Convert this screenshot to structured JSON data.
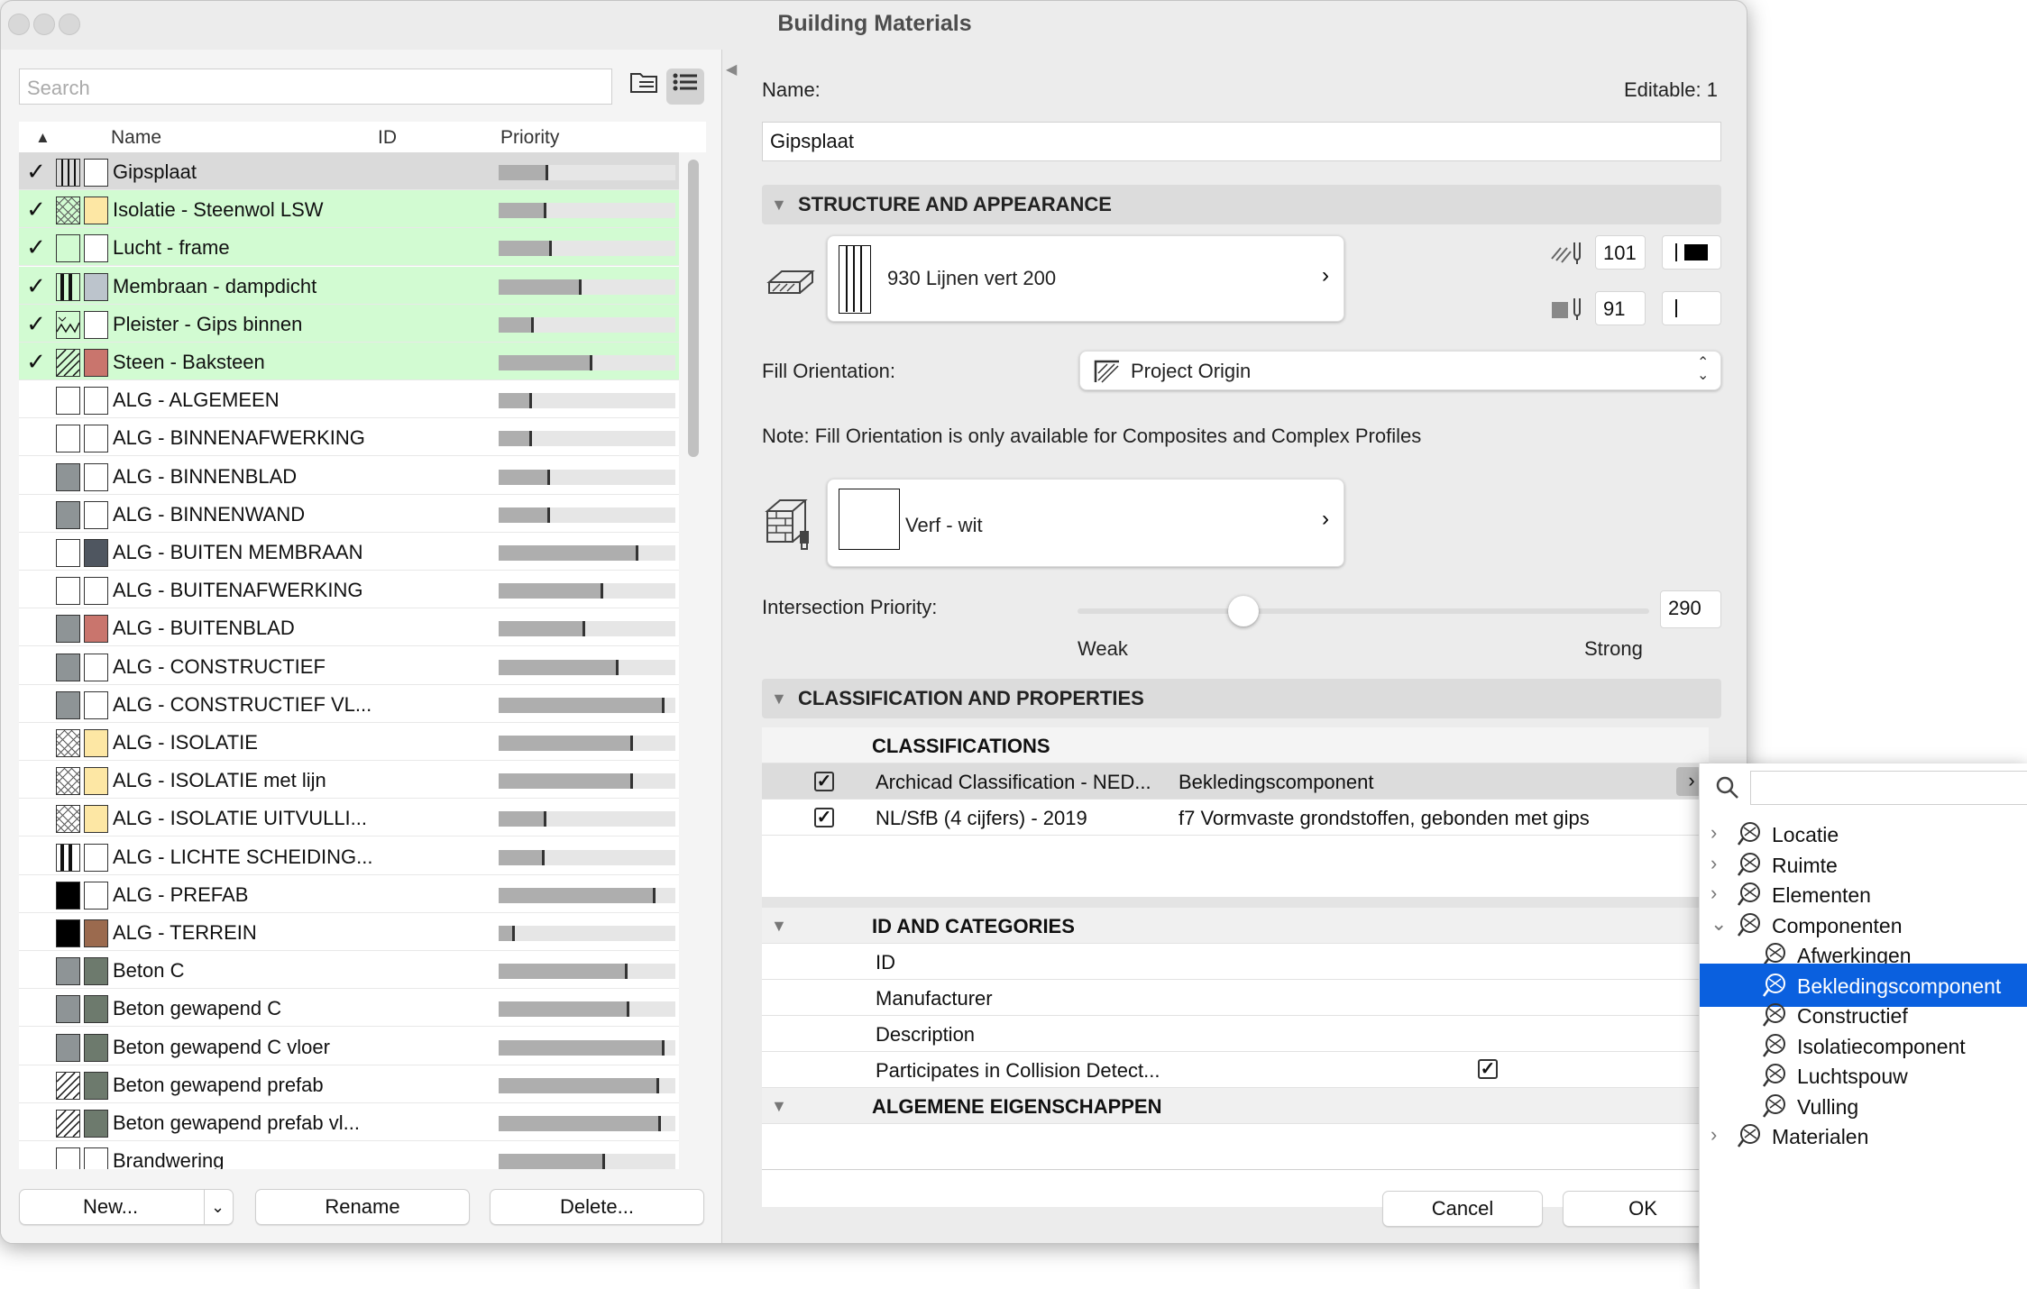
{
  "window": {
    "title": "Building Materials"
  },
  "left": {
    "search_placeholder": "Search",
    "columns": {
      "name": "Name",
      "id": "ID",
      "priority": "Priority"
    },
    "rows": [
      {
        "name": "Gipsplaat",
        "checked": true,
        "state": "selected",
        "priority": 0.28,
        "fill1": "vlines",
        "color": "#ffffff"
      },
      {
        "name": "Isolatie - Steenwol LSW",
        "checked": true,
        "state": "green",
        "priority": 0.27,
        "fill1": "cross",
        "color": "#fde7a4"
      },
      {
        "name": "Lucht - frame",
        "checked": true,
        "state": "green",
        "priority": 0.3,
        "fill1": "empty",
        "color": "#ffffff"
      },
      {
        "name": "Membraan - dampdicht",
        "checked": true,
        "state": "green",
        "priority": 0.47,
        "fill1": "vbold",
        "color": "#bcc4cc"
      },
      {
        "name": "Pleister - Gips binnen",
        "checked": true,
        "state": "green",
        "priority": 0.2,
        "fill1": "wave",
        "color": "#ffffff"
      },
      {
        "name": "Steen - Baksteen",
        "checked": true,
        "state": "green",
        "priority": 0.53,
        "fill1": "diag",
        "color": "#c9756d"
      },
      {
        "name": "ALG - ALGEMEEN",
        "priority": 0.19,
        "fill1": "empty",
        "color": "#ffffff"
      },
      {
        "name": "ALG - BINNENAFWERKING",
        "priority": 0.19,
        "fill1": "empty",
        "color": "#ffffff"
      },
      {
        "name": "ALG - BINNENBLAD",
        "priority": 0.29,
        "fill1": "gray",
        "color": "#ffffff"
      },
      {
        "name": "ALG - BINNENWAND",
        "priority": 0.29,
        "fill1": "gray",
        "color": "#ffffff"
      },
      {
        "name": "ALG - BUITEN MEMBRAAN",
        "priority": 0.79,
        "fill1": "empty",
        "color": "#4f5660"
      },
      {
        "name": "ALG - BUITENAFWERKING",
        "priority": 0.59,
        "fill1": "empty",
        "color": "#ffffff"
      },
      {
        "name": "ALG - BUITENBLAD",
        "priority": 0.49,
        "fill1": "gray",
        "color": "#c9756d"
      },
      {
        "name": "ALG - CONSTRUCTIEF",
        "priority": 0.68,
        "fill1": "gray",
        "color": "#ffffff"
      },
      {
        "name": "ALG - CONSTRUCTIEF VL...",
        "priority": 0.94,
        "fill1": "gray",
        "color": "#ffffff"
      },
      {
        "name": "ALG - ISOLATIE",
        "priority": 0.76,
        "fill1": "cross",
        "color": "#fde7a4"
      },
      {
        "name": "ALG - ISOLATIE met lijn",
        "priority": 0.76,
        "fill1": "cross",
        "color": "#fde7a4"
      },
      {
        "name": "ALG - ISOLATIE UITVULLI...",
        "priority": 0.27,
        "fill1": "cross",
        "color": "#fde7a4"
      },
      {
        "name": "ALG - LICHTE SCHEIDING...",
        "priority": 0.26,
        "fill1": "vbold",
        "color": "#ffffff"
      },
      {
        "name": "ALG - PREFAB",
        "priority": 0.89,
        "fill1": "black",
        "color": "#ffffff"
      },
      {
        "name": "ALG - TERREIN",
        "priority": 0.09,
        "fill1": "black",
        "color": "#9b6a4e"
      },
      {
        "name": "Beton C",
        "priority": 0.73,
        "fill1": "gray",
        "color": "#6d7a6d"
      },
      {
        "name": "Beton gewapend C",
        "priority": 0.74,
        "fill1": "gray",
        "color": "#6d7a6d"
      },
      {
        "name": "Beton gewapend C vloer",
        "priority": 0.94,
        "fill1": "gray",
        "color": "#6d7a6d"
      },
      {
        "name": "Beton gewapend prefab",
        "priority": 0.91,
        "fill1": "diag",
        "color": "#6d7a6d"
      },
      {
        "name": "Beton gewapend prefab vl...",
        "priority": 0.92,
        "fill1": "diag",
        "color": "#6d7a6d"
      },
      {
        "name": "Brandwering",
        "priority": 0.6,
        "fill1": "empty",
        "color": "#ffffff"
      }
    ],
    "buttons": {
      "new": "New...",
      "rename": "Rename",
      "delete": "Delete..."
    }
  },
  "right": {
    "name_label": "Name:",
    "editable_label": "Editable: 1",
    "name_value": "Gipsplaat",
    "structure_header": "STRUCTURE AND APPEARANCE",
    "fill_name": "930 Lijnen vert 200",
    "fg_pen": "101",
    "bg_pen": "91",
    "fill_orientation_label": "Fill Orientation:",
    "fill_orientation_value": "Project Origin",
    "note": "Note: Fill Orientation is only available for Composites and Complex Profiles",
    "surface_name": "Verf - wit",
    "intersection_label": "Intersection Priority:",
    "intersection_value": "290",
    "intersection_fraction": 0.29,
    "weak": "Weak",
    "strong": "Strong",
    "classification_header": "CLASSIFICATION AND PROPERTIES",
    "classifications_title": "CLASSIFICATIONS",
    "classifications": [
      {
        "system": "Archicad Classification - NED...",
        "value": "Bekledingscomponent"
      },
      {
        "system": "NL/SfB (4 cijfers) - 2019",
        "value": "f7 Vormvaste grondstoffen, gebonden met gips"
      }
    ],
    "id_categories_title": "ID AND CATEGORIES",
    "properties": [
      "ID",
      "Manufacturer",
      "Description",
      "Participates in Collision Detect..."
    ],
    "algemene_title": "ALGEMENE EIGENSCHAPPEN",
    "cancel": "Cancel",
    "ok": "OK"
  },
  "popup": {
    "items": [
      {
        "label": "Locatie",
        "level": 0,
        "state": "collapsed"
      },
      {
        "label": "Ruimte",
        "level": 0,
        "state": "collapsed"
      },
      {
        "label": "Elementen",
        "level": 0,
        "state": "collapsed"
      },
      {
        "label": "Componenten",
        "level": 0,
        "state": "expanded"
      },
      {
        "label": "Afwerkingen",
        "level": 1
      },
      {
        "label": "Bekledingscomponent",
        "level": 1,
        "selected": true
      },
      {
        "label": "Constructief",
        "level": 1
      },
      {
        "label": "Isolatiecomponent",
        "level": 1
      },
      {
        "label": "Luchtspouw",
        "level": 1
      },
      {
        "label": "Vulling",
        "level": 1
      },
      {
        "label": "Materialen",
        "level": 0,
        "state": "collapsed"
      }
    ]
  }
}
